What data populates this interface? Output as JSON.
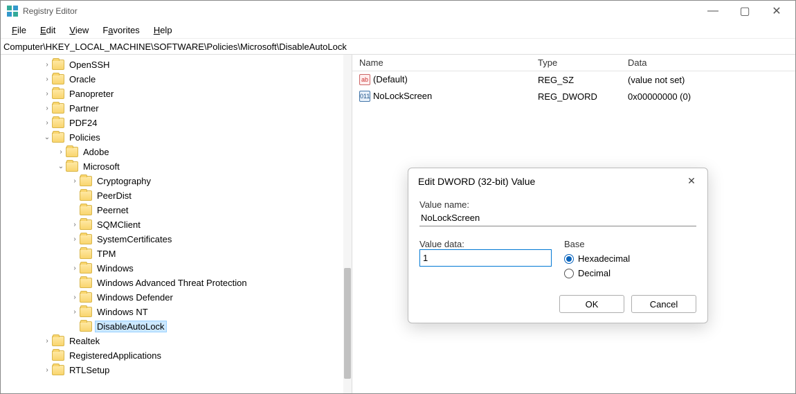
{
  "window": {
    "title": "Registry Editor",
    "controls": {
      "min": "—",
      "max": "▢",
      "close": "✕"
    }
  },
  "menu": {
    "file": "File",
    "edit": "Edit",
    "view": "View",
    "favorites": "Favorites",
    "help": "Help"
  },
  "path": "Computer\\HKEY_LOCAL_MACHINE\\SOFTWARE\\Policies\\Microsoft\\DisableAutoLock",
  "tree": {
    "openssh": "OpenSSH",
    "oracle": "Oracle",
    "panopreter": "Panopreter",
    "partner": "Partner",
    "pdf24": "PDF24",
    "policies": "Policies",
    "adobe": "Adobe",
    "microsoft": "Microsoft",
    "cryptography": "Cryptography",
    "peerdist": "PeerDist",
    "peernet": "Peernet",
    "sqmclient": "SQMClient",
    "systemcertificates": "SystemCertificates",
    "tpm": "TPM",
    "windows": "Windows",
    "watp": "Windows Advanced Threat Protection",
    "windefender": "Windows Defender",
    "winnt": "Windows NT",
    "disableautolock": "DisableAutoLock",
    "realtek": "Realtek",
    "regapps": "RegisteredApplications",
    "rtlsetup": "RTLSetup"
  },
  "columns": {
    "name": "Name",
    "type": "Type",
    "data": "Data"
  },
  "values": {
    "default": {
      "name": "(Default)",
      "type": "REG_SZ",
      "data": "(value not set)"
    },
    "nolock": {
      "name": "NoLockScreen",
      "type": "REG_DWORD",
      "data": "0x00000000 (0)"
    }
  },
  "dialog": {
    "title": "Edit DWORD (32-bit) Value",
    "valueNameLabel": "Value name:",
    "valueName": "NoLockScreen",
    "valueDataLabel": "Value data:",
    "valueData": "1",
    "baseLabel": "Base",
    "hex": "Hexadecimal",
    "dec": "Decimal",
    "ok": "OK",
    "cancel": "Cancel"
  }
}
